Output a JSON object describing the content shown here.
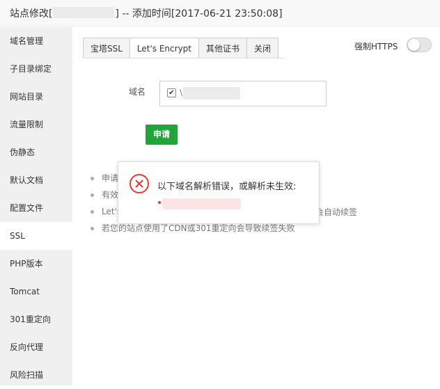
{
  "window": {
    "title_prefix": "站点修改[",
    "title_suffix": "] -- 添加时间[2017-06-21 23:50:08]"
  },
  "sidebar": {
    "items": [
      {
        "label": "域名管理"
      },
      {
        "label": "子目录绑定"
      },
      {
        "label": "网站目录"
      },
      {
        "label": "流量限制"
      },
      {
        "label": "伪静态"
      },
      {
        "label": "默认文档"
      },
      {
        "label": "配置文件"
      },
      {
        "label": "SSL",
        "active": true
      },
      {
        "label": "PHP版本"
      },
      {
        "label": "Tomcat"
      },
      {
        "label": "301重定向"
      },
      {
        "label": "反向代理"
      },
      {
        "label": "风险扫描"
      }
    ]
  },
  "tabs": [
    {
      "label": "宝塔SSL"
    },
    {
      "label": "Let's Encrypt",
      "active": true
    },
    {
      "label": "其他证书"
    },
    {
      "label": "关闭"
    }
  ],
  "force_https": {
    "label": "强制HTTPS",
    "enabled": false
  },
  "form": {
    "domain_label": "域名",
    "domain_checked": true,
    "domain_text": "\\",
    "apply_label": "申请"
  },
  "tips": [
    "申请",
    "有效",
    "Let's",
    "若您的站点使用了CDN或301重定向会导致续签失败"
  ],
  "tip_tail": "会自动续签",
  "dialog": {
    "message": "以下域名解析错误，或解析未生效:"
  },
  "colors": {
    "accent_green": "#20a53a",
    "error_red": "#e53935"
  },
  "icons": {
    "error": "error-circle-x-icon",
    "checkbox": "checkmark-icon"
  }
}
